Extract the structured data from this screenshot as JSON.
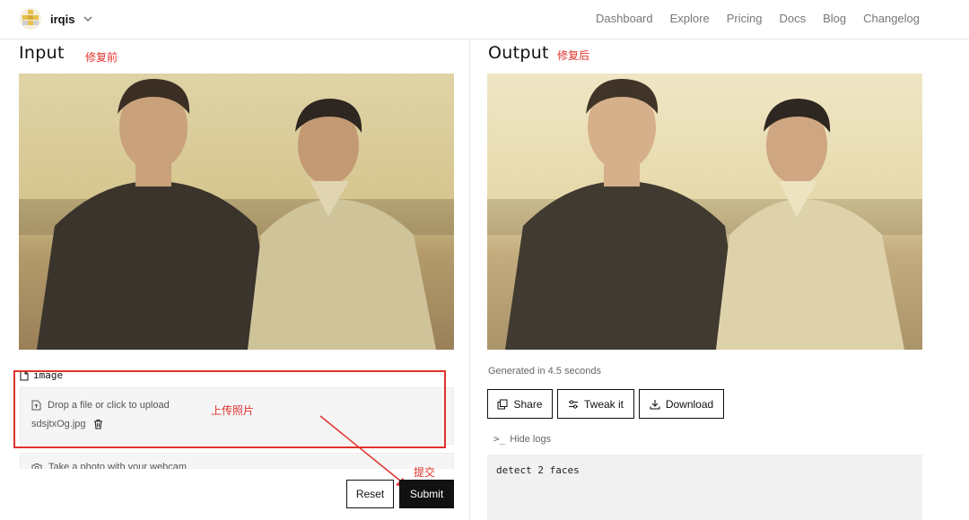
{
  "nav": {
    "brand": "irqis",
    "links": [
      "Dashboard",
      "Explore",
      "Pricing",
      "Docs",
      "Blog",
      "Changelog"
    ]
  },
  "input": {
    "heading": "Input",
    "note": "修复前",
    "field_label": "image",
    "drop_text": "Drop a file or click to upload",
    "file_name": "sdsjtxOg.jpg",
    "webcam_text": "Take a photo with your webcam",
    "upload_note": "上传照片",
    "submit_note": "提交",
    "reset_label": "Reset",
    "submit_label": "Submit"
  },
  "output": {
    "heading": "Output",
    "note": "修复后",
    "generated_text": "Generated in 4.5 seconds",
    "share_label": "Share",
    "tweak_label": "Tweak it",
    "download_label": "Download",
    "hide_logs_label": "Hide logs",
    "logs_text": "detect 2 faces"
  },
  "colors": {
    "annotation_red": "#e0322c",
    "button_dark": "#111111"
  }
}
